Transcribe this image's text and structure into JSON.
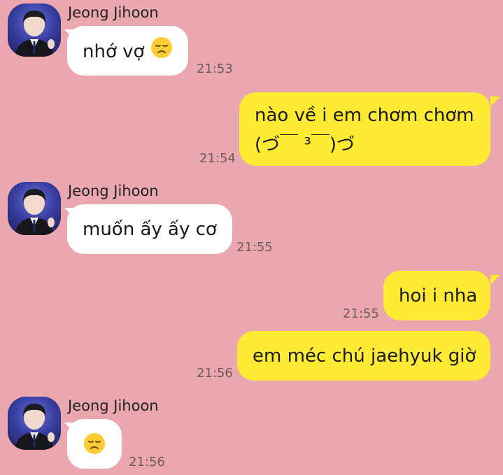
{
  "chat": {
    "messages": [
      {
        "sender": "Jeong Jihoon",
        "text": "nhớ vợ",
        "emoji": "disappointed-face",
        "time": "21:53",
        "direction": "incoming"
      },
      {
        "text_line1": "nào về i em chơm chơm",
        "text_line2": "(づ￣ ³￣)づ",
        "time": "21:54",
        "direction": "outgoing"
      },
      {
        "sender": "Jeong Jihoon",
        "text": "muốn ấy ấy cơ",
        "time": "21:55",
        "direction": "incoming"
      },
      {
        "text": "hoi i nha",
        "time": "21:55",
        "direction": "outgoing"
      },
      {
        "text": "em méc chú jaehyuk giờ",
        "time": "21:56",
        "direction": "outgoing"
      },
      {
        "sender": "Jeong Jihoon",
        "emoji": "disappointed-face",
        "time": "21:56",
        "direction": "incoming"
      }
    ]
  },
  "colors": {
    "background": "#EBA7B0",
    "incoming_bubble": "#FFFFFF",
    "outgoing_bubble": "#FFEB33"
  }
}
